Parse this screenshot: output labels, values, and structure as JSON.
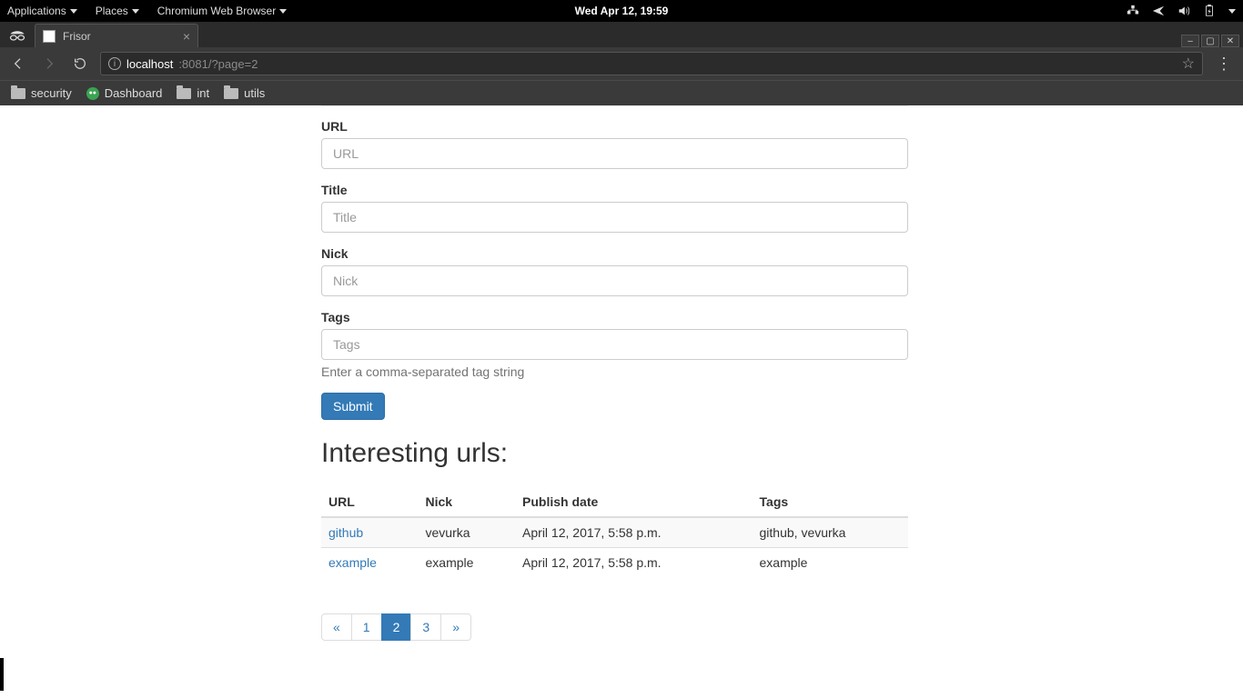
{
  "topbar": {
    "applications": "Applications",
    "places": "Places",
    "browser": "Chromium Web Browser",
    "clock": "Wed Apr 12, 19:59"
  },
  "tab": {
    "title": "Frisor"
  },
  "address": {
    "host": "localhost",
    "path": ":8081/?page=2"
  },
  "bookmarks": {
    "security": "security",
    "dashboard": "Dashboard",
    "int": "int",
    "utils": "utils"
  },
  "form": {
    "url_label": "URL",
    "url_placeholder": "URL",
    "title_label": "Title",
    "title_placeholder": "Title",
    "nick_label": "Nick",
    "nick_placeholder": "Nick",
    "tags_label": "Tags",
    "tags_placeholder": "Tags",
    "tags_help": "Enter a comma-separated tag string",
    "submit": "Submit"
  },
  "table": {
    "heading": "Interesting urls:",
    "cols": {
      "url": "URL",
      "nick": "Nick",
      "date": "Publish date",
      "tags": "Tags"
    },
    "rows": [
      {
        "url": "github",
        "nick": "vevurka",
        "date": "April 12, 2017, 5:58 p.m.",
        "tags": "github, vevurka"
      },
      {
        "url": "example",
        "nick": "example",
        "date": "April 12, 2017, 5:58 p.m.",
        "tags": "example"
      }
    ]
  },
  "pagination": {
    "prev": "«",
    "p1": "1",
    "p2": "2",
    "p3": "3",
    "next": "»"
  }
}
